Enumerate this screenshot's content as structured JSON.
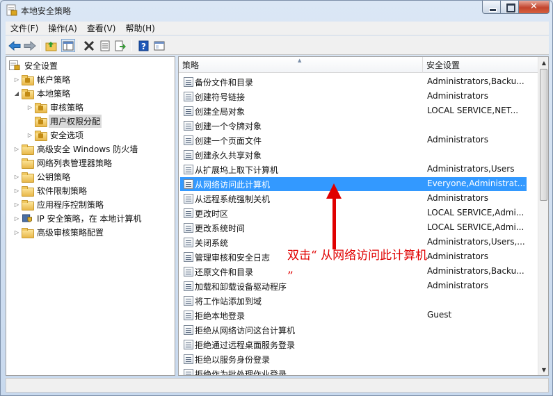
{
  "window": {
    "title": "本地安全策略"
  },
  "menu": [
    "文件(F)",
    "操作(A)",
    "查看(V)",
    "帮助(H)"
  ],
  "toolbar": [
    "back-icon",
    "forward-icon",
    "up-folder-icon",
    "show-tree-icon",
    "delete-icon",
    "properties-icon",
    "export-icon",
    "help-icon",
    "console-icon"
  ],
  "tree": {
    "root": "安全设置",
    "items": [
      {
        "label": "帐户策略",
        "level": 1,
        "expander": "▷",
        "icon": "folder-lock"
      },
      {
        "label": "本地策略",
        "level": 1,
        "expander": "◢",
        "icon": "folder-lock"
      },
      {
        "label": "审核策略",
        "level": 2,
        "expander": "▷",
        "icon": "folder-lock"
      },
      {
        "label": "用户权限分配",
        "level": 2,
        "expander": "",
        "icon": "folder-lock",
        "selected": true
      },
      {
        "label": "安全选项",
        "level": 2,
        "expander": "▷",
        "icon": "folder-lock"
      },
      {
        "label": "高级安全 Windows 防火墙",
        "level": 1,
        "expander": "▷",
        "icon": "folder"
      },
      {
        "label": "网络列表管理器策略",
        "level": 1,
        "expander": "",
        "icon": "folder"
      },
      {
        "label": "公钥策略",
        "level": 1,
        "expander": "▷",
        "icon": "folder"
      },
      {
        "label": "软件限制策略",
        "level": 1,
        "expander": "▷",
        "icon": "folder"
      },
      {
        "label": "应用程序控制策略",
        "level": 1,
        "expander": "▷",
        "icon": "folder"
      },
      {
        "label": "IP 安全策略，在 本地计算机",
        "level": 1,
        "expander": "▷",
        "icon": "shield"
      },
      {
        "label": "高级审核策略配置",
        "level": 1,
        "expander": "▷",
        "icon": "folder"
      }
    ]
  },
  "columns": {
    "policy": "策略",
    "setting": "安全设置"
  },
  "policies": [
    {
      "name": "备份文件和目录",
      "setting": "Administrators,Backu..."
    },
    {
      "name": "创建符号链接",
      "setting": "Administrators"
    },
    {
      "name": "创建全局对象",
      "setting": "LOCAL SERVICE,NET..."
    },
    {
      "name": "创建一个令牌对象",
      "setting": ""
    },
    {
      "name": "创建一个页面文件",
      "setting": "Administrators"
    },
    {
      "name": "创建永久共享对象",
      "setting": ""
    },
    {
      "name": "从扩展坞上取下计算机",
      "setting": "Administrators,Users"
    },
    {
      "name": "从网络访问此计算机",
      "setting": "Everyone,Administrat...",
      "selected": true
    },
    {
      "name": "从远程系统强制关机",
      "setting": "Administrators"
    },
    {
      "name": "更改时区",
      "setting": "LOCAL SERVICE,Admi..."
    },
    {
      "name": "更改系统时间",
      "setting": "LOCAL SERVICE,Admi..."
    },
    {
      "name": "关闭系统",
      "setting": "Administrators,Users,..."
    },
    {
      "name": "管理审核和安全日志",
      "setting": "Administrators"
    },
    {
      "name": "还原文件和目录",
      "setting": "Administrators,Backu..."
    },
    {
      "name": "加载和卸载设备驱动程序",
      "setting": "Administrators"
    },
    {
      "name": "将工作站添加到域",
      "setting": ""
    },
    {
      "name": "拒绝本地登录",
      "setting": "Guest"
    },
    {
      "name": "拒绝从网络访问这台计算机",
      "setting": ""
    },
    {
      "name": "拒绝通过远程桌面服务登录",
      "setting": ""
    },
    {
      "name": "拒绝以服务身份登录",
      "setting": ""
    },
    {
      "name": "拒绝作为批处理作业登录",
      "setting": ""
    }
  ],
  "annotation": {
    "text": "双击“ 从网络访问此计算机 ”",
    "color": "#e00000"
  },
  "colors": {
    "selection": "#3399ff"
  }
}
